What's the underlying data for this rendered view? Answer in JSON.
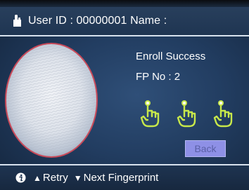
{
  "header": {
    "user_info": "User ID : 00000001 Name :",
    "icon": "user-icon"
  },
  "enroll": {
    "status": "Enroll Success",
    "fp_no": "FP No : 2",
    "captures": 3,
    "capture_icon": "finger-touch-icon",
    "capture_color": "#c8e84a"
  },
  "back_button": {
    "label": "Back",
    "color": "#8e90e6"
  },
  "footer": {
    "info_icon": "info-icon",
    "retry_arrow": "▲",
    "retry_label": "Retry",
    "next_arrow": "▼",
    "next_label": "Next Fingerprint"
  },
  "colors": {
    "background": "#223d61",
    "fingerprint_border": "#c94a5a",
    "divider": "#d8e2ee"
  }
}
